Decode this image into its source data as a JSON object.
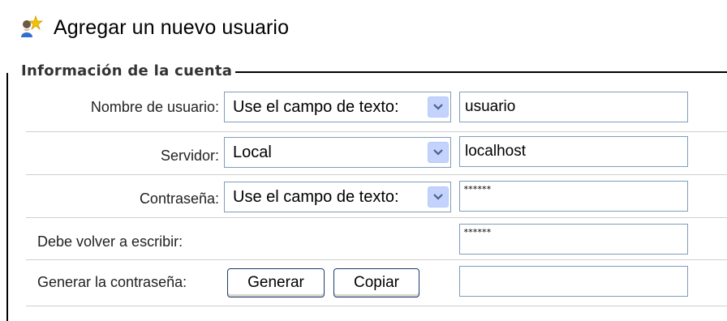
{
  "header": {
    "title": "Agregar un nuevo usuario",
    "icon": "add-user-icon"
  },
  "fieldset": {
    "legend": "Información de la cuenta"
  },
  "rows": {
    "username": {
      "label": "Nombre de usuario:",
      "select_value": "Use el campo de texto:",
      "input_value": "usuario"
    },
    "server": {
      "label": "Servidor:",
      "select_value": "Local",
      "input_value": "localhost"
    },
    "password": {
      "label": "Contraseña:",
      "select_value": "Use el campo de texto:",
      "input_value_masked": "******"
    },
    "retype": {
      "label": "Debe volver a escribir:",
      "input_value_masked": "******"
    },
    "generate": {
      "label": "Generar la contraseña:",
      "generate_button": "Generar",
      "copy_button": "Copiar",
      "input_value": ""
    }
  },
  "colors": {
    "input_border": "#7f9db9",
    "dropdown_arrow_bg": "#c3d3fd",
    "button_border": "#1c3c6e",
    "row_separator": "#cfcfcf"
  }
}
